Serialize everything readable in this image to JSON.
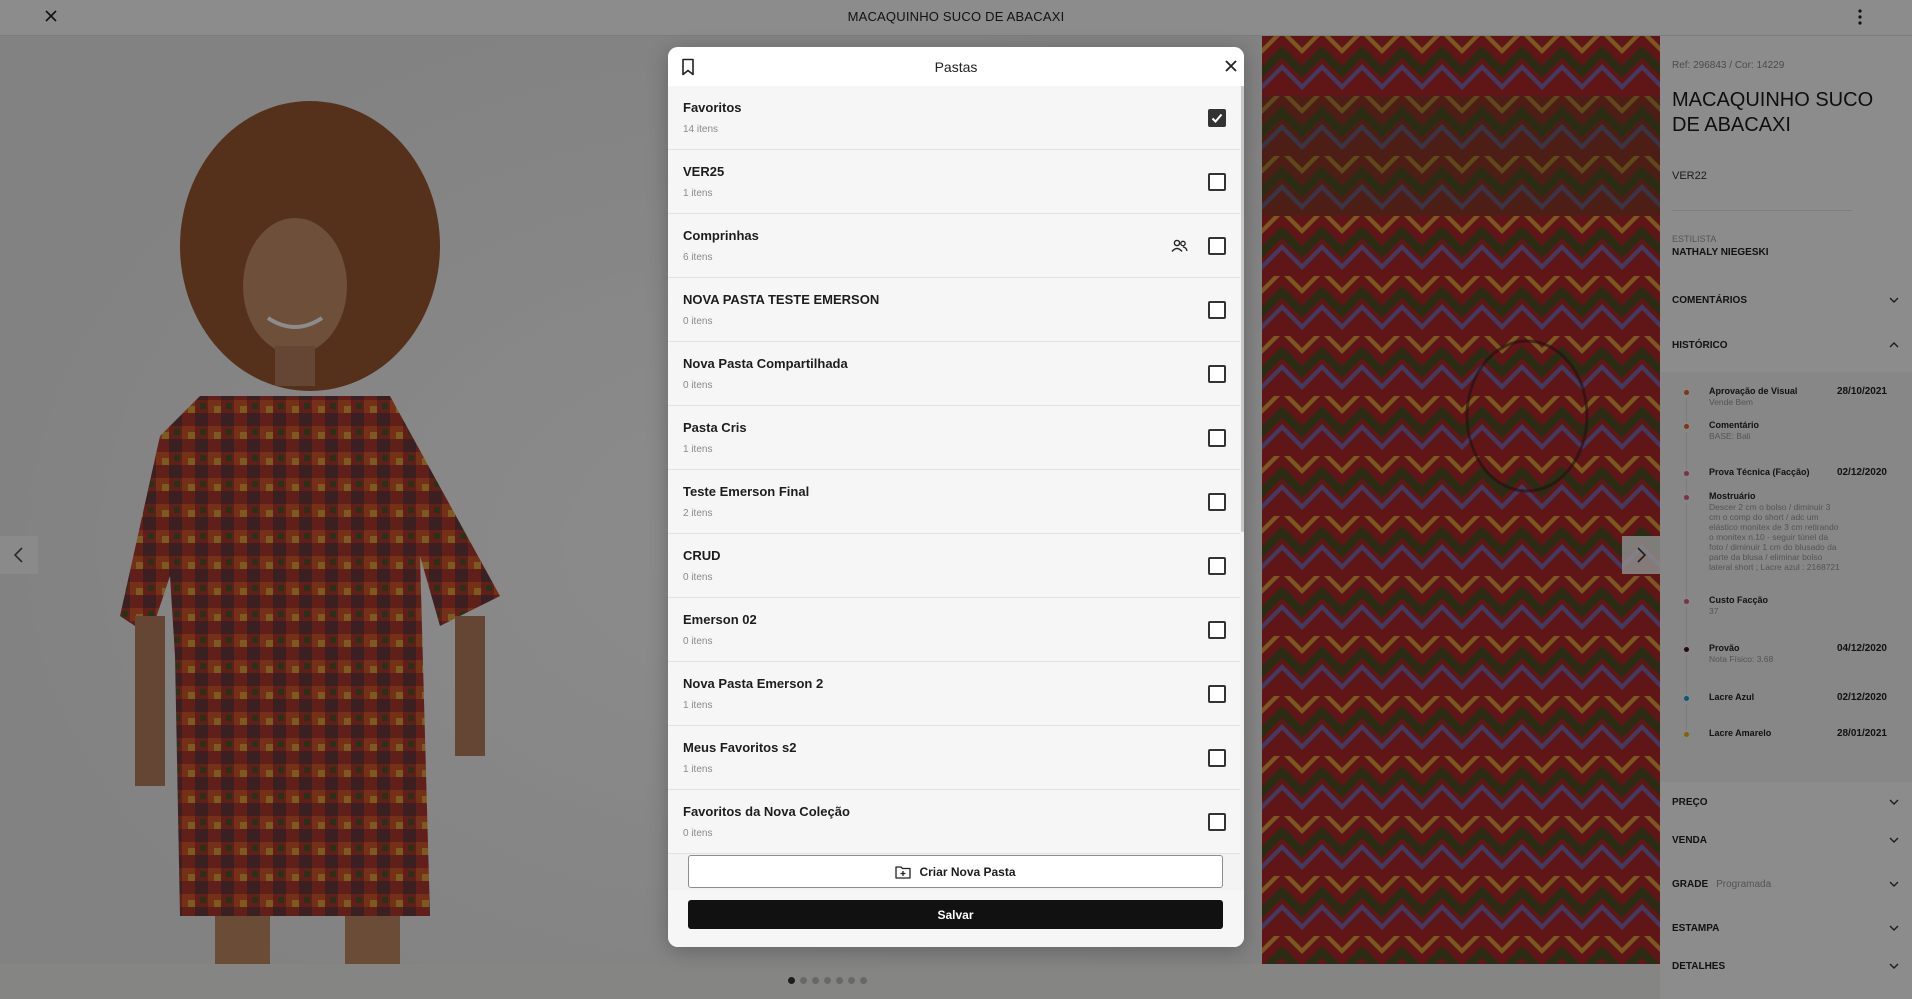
{
  "topbar": {
    "title": "MACAQUINHO SUCO DE ABACAXI"
  },
  "product": {
    "ref": "Ref: 296843 / Cor: 14229",
    "title": "MACAQUINHO SUCO DE ABACAXI",
    "collection": "VER22",
    "stylist_label": "ESTILISTA",
    "stylist_name": "NATHALY NIEGESKI"
  },
  "accordions": {
    "comentarios": "COMENTÁRIOS",
    "historico": "HISTÓRICO",
    "preco": "PREÇO",
    "venda": "VENDA",
    "grade": "GRADE",
    "grade_sub": "Programada",
    "estampa": "ESTAMPA",
    "detalhes": "DETALHES"
  },
  "history": [
    {
      "name": "Aprovação de Visual",
      "date": "28/10/2021",
      "desc": "Vende Bem",
      "color": "#e8632b"
    },
    {
      "name": "Comentário",
      "date": "",
      "desc": "BASE: Bali",
      "color": "#e8632b"
    },
    {
      "name": "Prova Técnica (Facção)",
      "date": "02/12/2020",
      "desc": "",
      "color": "#e05a8a"
    },
    {
      "name": "Mostruário",
      "date": "",
      "desc": "Descer 2 cm o bolso / diminuir 3 cm o comp do short / adc um elástico monitex de 3 cm retirando o monitex n.10 - seguir túnel da foto / diminuir 1 cm do blusado da parte da blusa / eliminar bolso lateral short ; Lacre azul : 2168721",
      "color": "#e05a8a"
    },
    {
      "name": "Custo Facção",
      "date": "",
      "desc": "37",
      "color": "#e05a8a"
    },
    {
      "name": "Provão",
      "date": "04/12/2020",
      "desc": "Nota Físico: 3.68",
      "color": "#4a1020"
    },
    {
      "name": "Lacre Azul",
      "date": "02/12/2020",
      "desc": "",
      "color": "#1a9fd6"
    },
    {
      "name": "Lacre Amarelo",
      "date": "28/01/2021",
      "desc": "",
      "color": "#f2b400"
    }
  ],
  "modal": {
    "title": "Pastas",
    "new_folder_label": "Criar Nova Pasta",
    "save_label": "Salvar",
    "folders": [
      {
        "name": "Favoritos",
        "count": "14 itens",
        "checked": true,
        "shared": false
      },
      {
        "name": "VER25",
        "count": "1 itens",
        "checked": false,
        "shared": false
      },
      {
        "name": "Comprinhas",
        "count": "6 itens",
        "checked": false,
        "shared": true
      },
      {
        "name": "NOVA PASTA TESTE EMERSON",
        "count": "0 itens",
        "checked": false,
        "shared": false
      },
      {
        "name": "Nova Pasta Compartilhada",
        "count": "0 itens",
        "checked": false,
        "shared": false
      },
      {
        "name": "Pasta Cris",
        "count": "1 itens",
        "checked": false,
        "shared": false
      },
      {
        "name": "Teste Emerson Final",
        "count": "2 itens",
        "checked": false,
        "shared": false
      },
      {
        "name": "CRUD",
        "count": "0 itens",
        "checked": false,
        "shared": false
      },
      {
        "name": "Emerson 02",
        "count": "0 itens",
        "checked": false,
        "shared": false
      },
      {
        "name": "Nova Pasta Emerson 2",
        "count": "1 itens",
        "checked": false,
        "shared": false
      },
      {
        "name": "Meus Favoritos s2",
        "count": "1 itens",
        "checked": false,
        "shared": false
      },
      {
        "name": "Favoritos da Nova Coleção",
        "count": "0 itens",
        "checked": false,
        "shared": false
      }
    ]
  },
  "carousel": {
    "total": 7,
    "active": 1
  },
  "icons": [
    "close-icon",
    "more-vertical-icon",
    "chevron-left-icon",
    "chevron-right-icon",
    "chevron-down-icon",
    "chevron-up-icon",
    "bookmark-icon",
    "users-icon",
    "checkbox-icon",
    "folder-plus-icon"
  ]
}
